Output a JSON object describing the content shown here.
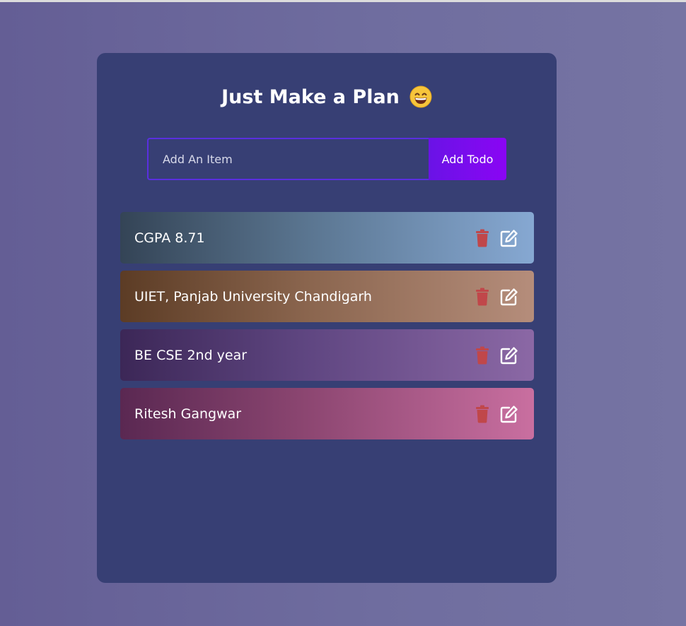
{
  "header": {
    "title": "Just Make a Plan",
    "emoji": "grinning-face-emoji"
  },
  "input": {
    "placeholder": "Add An Item",
    "value": "",
    "button_label": "Add Todo"
  },
  "todos": [
    {
      "text": "CGPA 8.71"
    },
    {
      "text": "UIET, Panjab University Chandigarh"
    },
    {
      "text": "BE CSE 2nd year"
    },
    {
      "text": "Ritesh Gangwar"
    }
  ],
  "icons": {
    "delete": "trash-icon",
    "edit": "edit-icon"
  },
  "colors": {
    "background": "#6f6d9f",
    "card": "#373f74",
    "accent": "#8a05f4",
    "delete": "#c0474a",
    "text": "#ffffff"
  }
}
